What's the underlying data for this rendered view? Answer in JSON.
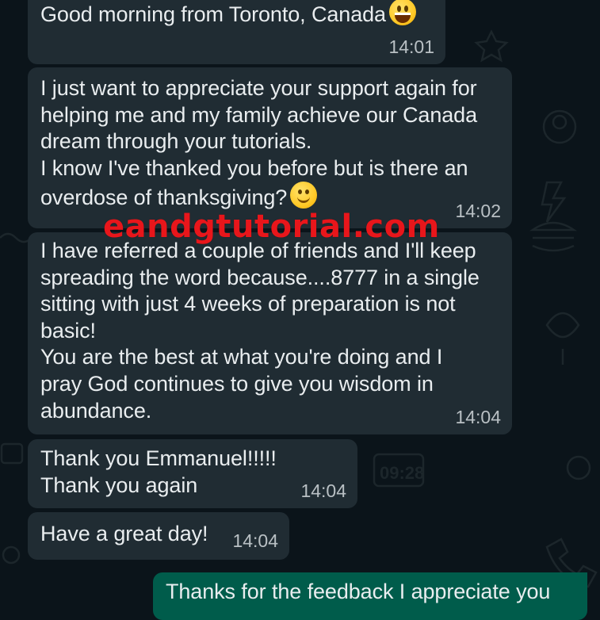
{
  "conversation": {
    "messages": [
      {
        "direction": "incoming",
        "text": "Good morning from Toronto, Canada",
        "emoji": "grinning-face",
        "time": "14:01"
      },
      {
        "direction": "incoming",
        "text": "I just want to appreciate your support again for helping me and my family achieve our Canada dream through your tutorials.\nI know I've thanked you before but is there an overdose of thanksgiving?",
        "emoji": "smiling-face",
        "time": "14:02"
      },
      {
        "direction": "incoming",
        "text": "I have referred a couple of friends and I'll keep spreading the word because....8777 in a single sitting with just 4 weeks of preparation is not basic!\nYou are the best at what you're doing and I pray God continues to give you wisdom in abundance.",
        "time": "14:04"
      },
      {
        "direction": "incoming",
        "text": "Thank you Emmanuel!!!!!\nThank you again",
        "time": "14:04"
      },
      {
        "direction": "incoming",
        "text": "Have a great day!",
        "time": "14:04"
      },
      {
        "direction": "outgoing",
        "text": "Thanks for the feedback I appreciate you"
      }
    ]
  },
  "watermark": {
    "text": "eandgtutorial.com"
  },
  "colors": {
    "background": "#0b141a",
    "incoming_bubble": "#202c33",
    "outgoing_bubble": "#005c4b",
    "message_text": "#e9edef",
    "timestamp": "#b9c0c4",
    "watermark": "#e8161b"
  }
}
